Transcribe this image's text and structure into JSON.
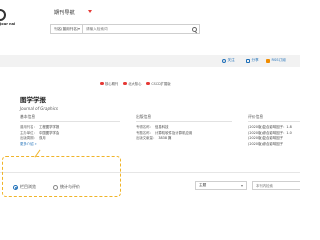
{
  "header": {
    "logo_text": "Jour\nnal",
    "nav_title": "期刊导航",
    "search": {
      "scope": "刊名(曾用刊名)",
      "placeholder": "请输入检索词"
    }
  },
  "banner": {
    "actions": [
      {
        "label": "关注",
        "icon": "plus-icon"
      },
      {
        "label": "分享",
        "icon": "share-icon"
      },
      {
        "label": "RSS订阅",
        "icon": "rss-icon"
      }
    ]
  },
  "journal": {
    "name": "图学学报",
    "name_en": "Journal of Graphics",
    "badges": [
      "核心期刊",
      "北大核心",
      "CSCD扩展版"
    ]
  },
  "info": {
    "basic": {
      "title": "基本信息",
      "rows": [
        {
          "k": "曾用刊名：",
          "v": "工程图学学报"
        },
        {
          "k": "主办单位：",
          "v": "中国图学学会"
        },
        {
          "k": "出版周期：",
          "v": "双月"
        }
      ],
      "more": "更多介绍 »"
    },
    "pub": {
      "title": "出版信息",
      "rows": [
        {
          "k": "专辑名称：",
          "v": "信息科技"
        },
        {
          "k": "专题名称：",
          "v": "计算机软件及计算机应用"
        },
        {
          "k": "出版文献量：",
          "v": "3838 篇"
        }
      ]
    },
    "eval": {
      "title": "评价信息",
      "rows": [
        {
          "k": "",
          "v": "(2020版)复合影响因子：1.8"
        },
        {
          "k": "",
          "v": "(2020版)综合影响因子：1.0"
        },
        {
          "k": "",
          "v": "(2020版)复合影响因子"
        },
        {
          "k": "",
          "v": "(2020版)综合影响因子"
        }
      ]
    }
  },
  "bottom": {
    "options": [
      {
        "label": "栏目浏览",
        "selected": true
      },
      {
        "label": "统计与评价",
        "selected": false
      }
    ],
    "filter_select": "主题",
    "filter_placeholder": "本刊内检索"
  }
}
